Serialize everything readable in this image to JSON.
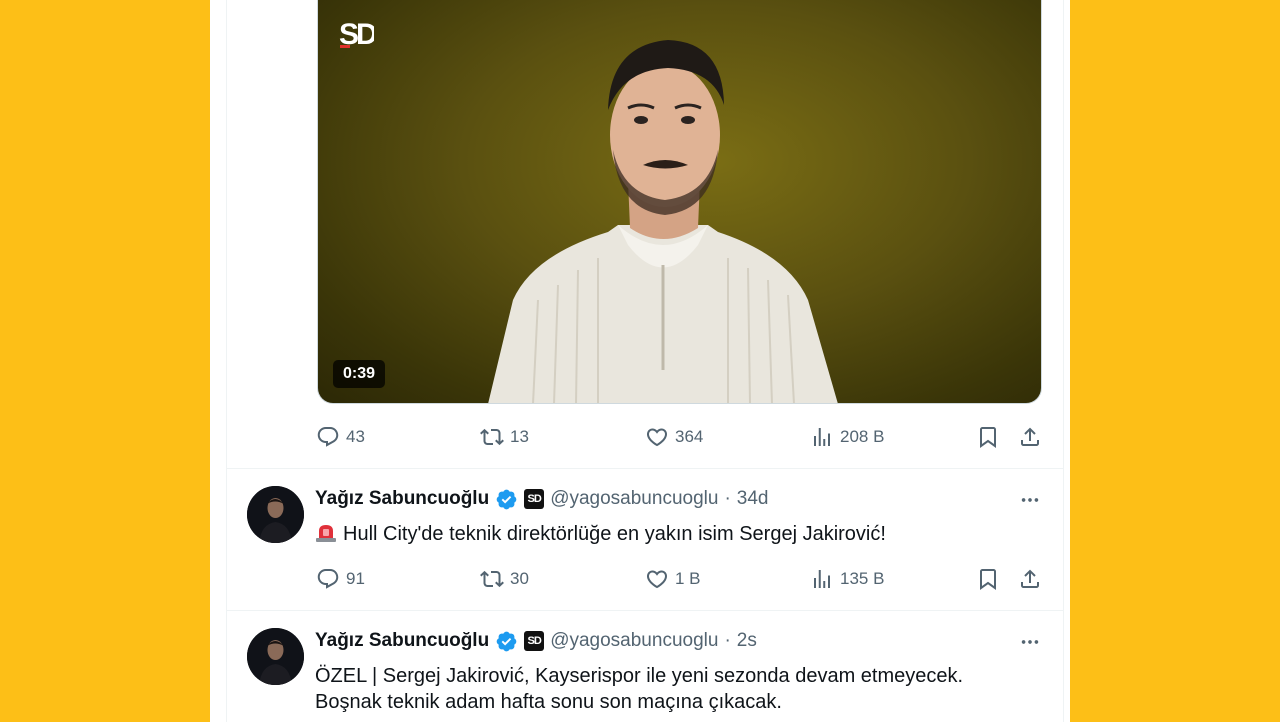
{
  "video": {
    "logo_text": "SD",
    "duration": "0:39"
  },
  "tweet1_actions": {
    "replies": "43",
    "retweets": "13",
    "likes": "364",
    "views": "208 B"
  },
  "tweet2": {
    "name": "Yağız Sabuncuoğlu",
    "badge": "SD",
    "handle": "@yagosabuncuoglu",
    "dot": "·",
    "time": "34d",
    "text": "Hull City'de teknik direktörlüğe en yakın isim Sergej Jakirović!",
    "replies": "91",
    "retweets": "30",
    "likes": "1 B",
    "views": "135 B"
  },
  "tweet3": {
    "name": "Yağız Sabuncuoğlu",
    "badge": "SD",
    "handle": "@yagosabuncuoglu",
    "dot": "·",
    "time": "2s",
    "text_line1": "ÖZEL | Sergej Jakirović, Kayserispor ile yeni sezonda devam etmeyecek.",
    "text_line2": "Boşnak teknik adam hafta sonu son maçına çıkacak."
  },
  "colors": {
    "background": "#FDBF17",
    "verified": "#1D9BF0",
    "muted": "#536471"
  }
}
